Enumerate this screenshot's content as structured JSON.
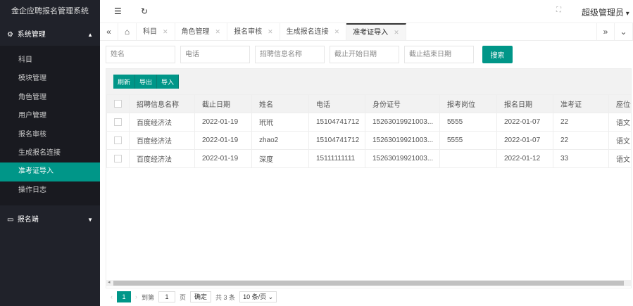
{
  "app": {
    "title": "金企应聘报名管理系统",
    "user": "超级管理员"
  },
  "sidebar": {
    "group1": "系统管理",
    "items": [
      "科目",
      "模块管理",
      "角色管理",
      "用户管理",
      "报名审核",
      "生成报名连接",
      "准考证导入",
      "操作日志"
    ],
    "active": 6,
    "group2": "报名端"
  },
  "tabs": [
    "科目",
    "角色管理",
    "报名审核",
    "生成报名连接",
    "准考证导入"
  ],
  "search": {
    "name": "姓名",
    "phone": "电话",
    "job": "招聘信息名称",
    "start": "截止开始日期",
    "end": "截止结束日期",
    "button": "搜索"
  },
  "toolbar": {
    "refresh": "刷新",
    "export": "导出",
    "import": "导入"
  },
  "table": {
    "headers": [
      "招聘信息名称",
      "截止日期",
      "姓名",
      "电话",
      "身份证号",
      "报考岗位",
      "报名日期",
      "准考证",
      "座位号"
    ],
    "rows": [
      [
        "百度经济法",
        "2022-01-19",
        "玳玳",
        "15104741712",
        "15263019921003...",
        "5555",
        "2022-01-07",
        "22",
        "语文"
      ],
      [
        "百度经济法",
        "2022-01-19",
        "zhao2",
        "15104741712",
        "15263019921003...",
        "5555",
        "2022-01-07",
        "22",
        "语文"
      ],
      [
        "百度经济法",
        "2022-01-19",
        "深度",
        "15111111111",
        "15263019921003...",
        "",
        "2022-01-12",
        "33",
        "语文"
      ]
    ]
  },
  "pager": {
    "page": "1",
    "goto": "到第",
    "goto_val": "1",
    "page_unit": "页",
    "confirm": "确定",
    "total": "共 3 条",
    "size": "10 条/页"
  }
}
